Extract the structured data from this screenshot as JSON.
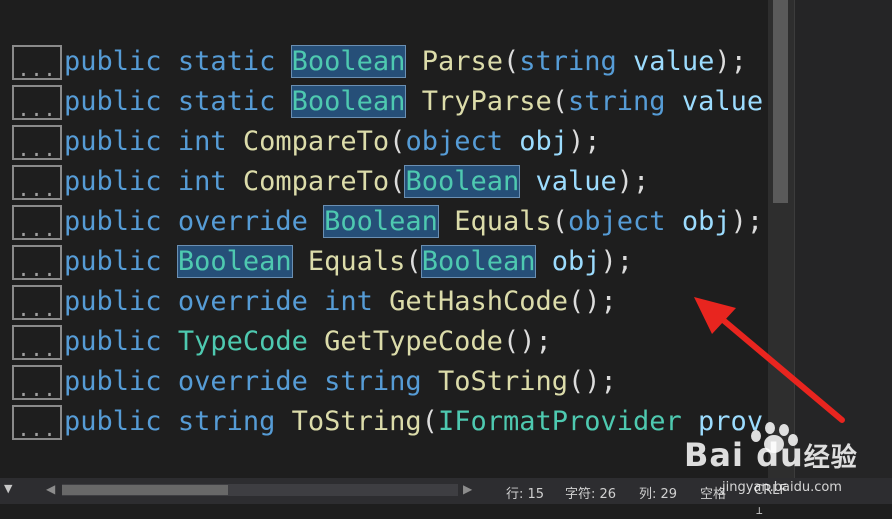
{
  "colors": {
    "background": "#1e1e1e",
    "keyword": "#569cd6",
    "type": "#4ec9b0",
    "method": "#dcdcaa",
    "identifier": "#9cdcfe",
    "highlight": "#264f78",
    "arrow": "#e8251f"
  },
  "editor": {
    "lines": [
      {
        "fold": "...",
        "tokens": [
          [
            "kw",
            "public"
          ],
          [
            "sp",
            " "
          ],
          [
            "kw",
            "static"
          ],
          [
            "sp",
            " "
          ],
          [
            "hl",
            "Boolean"
          ],
          [
            "sp",
            " "
          ],
          [
            "fn",
            "Parse"
          ],
          [
            "pn",
            "("
          ],
          [
            "kw",
            "string"
          ],
          [
            "sp",
            " "
          ],
          [
            "id",
            "value"
          ],
          [
            "pn",
            ");"
          ]
        ]
      },
      {
        "fold": "...",
        "tokens": [
          [
            "kw",
            "public"
          ],
          [
            "sp",
            " "
          ],
          [
            "kw",
            "static"
          ],
          [
            "sp",
            " "
          ],
          [
            "hl",
            "Boolean"
          ],
          [
            "sp",
            " "
          ],
          [
            "fn",
            "TryParse"
          ],
          [
            "pn",
            "("
          ],
          [
            "kw",
            "string"
          ],
          [
            "sp",
            " "
          ],
          [
            "id",
            "value"
          ],
          [
            "pn",
            ","
          ]
        ]
      },
      {
        "fold": "...",
        "tokens": [
          [
            "kw",
            "public"
          ],
          [
            "sp",
            " "
          ],
          [
            "kw",
            "int"
          ],
          [
            "sp",
            " "
          ],
          [
            "fn",
            "CompareTo"
          ],
          [
            "pn",
            "("
          ],
          [
            "kw",
            "object"
          ],
          [
            "sp",
            " "
          ],
          [
            "id",
            "obj"
          ],
          [
            "pn",
            ");"
          ]
        ]
      },
      {
        "fold": "...",
        "tokens": [
          [
            "kw",
            "public"
          ],
          [
            "sp",
            " "
          ],
          [
            "kw",
            "int"
          ],
          [
            "sp",
            " "
          ],
          [
            "fn",
            "CompareTo"
          ],
          [
            "pn",
            "("
          ],
          [
            "hl",
            "Boolean"
          ],
          [
            "sp",
            " "
          ],
          [
            "id",
            "value"
          ],
          [
            "pn",
            ");"
          ]
        ]
      },
      {
        "fold": "...",
        "tokens": [
          [
            "kw",
            "public"
          ],
          [
            "sp",
            " "
          ],
          [
            "kw",
            "override"
          ],
          [
            "sp",
            " "
          ],
          [
            "hl",
            "Boolean"
          ],
          [
            "sp",
            " "
          ],
          [
            "fn",
            "Equals"
          ],
          [
            "pn",
            "("
          ],
          [
            "kw",
            "object"
          ],
          [
            "sp",
            " "
          ],
          [
            "id",
            "obj"
          ],
          [
            "pn",
            ");"
          ]
        ]
      },
      {
        "fold": "...",
        "tokens": [
          [
            "kw",
            "public"
          ],
          [
            "sp",
            " "
          ],
          [
            "hl",
            "Boolean"
          ],
          [
            "sp",
            " "
          ],
          [
            "fn",
            "Equals"
          ],
          [
            "pn",
            "("
          ],
          [
            "hl",
            "Boolean"
          ],
          [
            "sp",
            " "
          ],
          [
            "id",
            "obj"
          ],
          [
            "pn",
            ");"
          ]
        ]
      },
      {
        "fold": "...",
        "tokens": [
          [
            "kw",
            "public"
          ],
          [
            "sp",
            " "
          ],
          [
            "kw",
            "override"
          ],
          [
            "sp",
            " "
          ],
          [
            "kw",
            "int"
          ],
          [
            "sp",
            " "
          ],
          [
            "fn",
            "GetHashCode"
          ],
          [
            "pn",
            "();"
          ]
        ]
      },
      {
        "fold": "...",
        "tokens": [
          [
            "kw",
            "public"
          ],
          [
            "sp",
            " "
          ],
          [
            "ty",
            "TypeCode"
          ],
          [
            "sp",
            " "
          ],
          [
            "fn",
            "GetTypeCode"
          ],
          [
            "pn",
            "();"
          ]
        ]
      },
      {
        "fold": "...",
        "tokens": [
          [
            "kw",
            "public"
          ],
          [
            "sp",
            " "
          ],
          [
            "kw",
            "override"
          ],
          [
            "sp",
            " "
          ],
          [
            "kw",
            "string"
          ],
          [
            "sp",
            " "
          ],
          [
            "fn",
            "ToString"
          ],
          [
            "pn",
            "();"
          ]
        ]
      },
      {
        "fold": "...",
        "tokens": [
          [
            "kw",
            "public"
          ],
          [
            "sp",
            " "
          ],
          [
            "kw",
            "string"
          ],
          [
            "sp",
            " "
          ],
          [
            "fn",
            "ToString"
          ],
          [
            "pn",
            "("
          ],
          [
            "ty",
            "IFormatProvider"
          ],
          [
            "sp",
            " "
          ],
          [
            "id",
            "prov"
          ]
        ]
      }
    ]
  },
  "statusbar": {
    "line": "行: 15",
    "char": "字符: 26",
    "col": "列: 29",
    "mode": "空格",
    "eol": "CRLF"
  },
  "watermark": {
    "brand": "Bai du",
    "cn": "经验",
    "sub": "jingyan.baidu.com"
  }
}
